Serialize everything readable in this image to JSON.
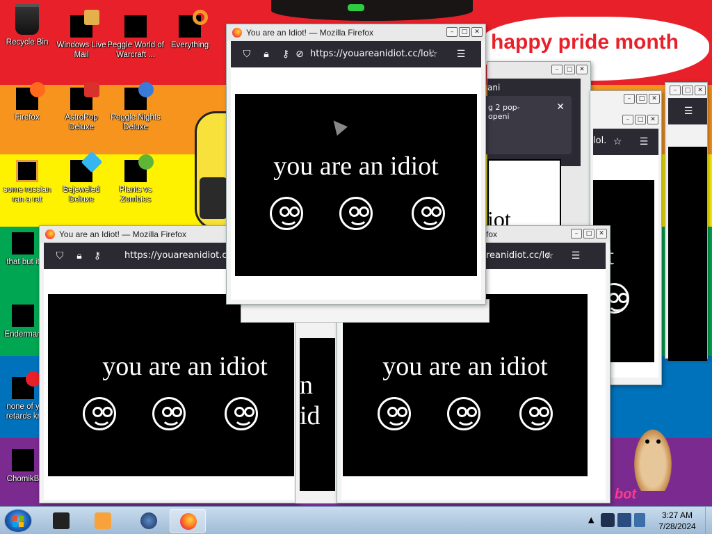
{
  "wallpaper": {
    "bands": [
      "#e8202a",
      "#f7941d",
      "#fff200",
      "#00a651",
      "#0072bc",
      "#7b2b8f"
    ],
    "banner_text": "happy pride month",
    "corner_text": "bot"
  },
  "desktop_icons": [
    {
      "label": "Recycle Bin",
      "icon": "recycle-bin-icon"
    },
    {
      "label": "Windows Live Mail",
      "icon": "mail-icon"
    },
    {
      "label": "Peggle World of Warcraft ...",
      "icon": "peggle-icon"
    },
    {
      "label": "Everything",
      "icon": "search-icon"
    },
    {
      "label": "Firefox",
      "icon": "firefox-icon"
    },
    {
      "label": "AstroPop Deluxe",
      "icon": "game-icon"
    },
    {
      "label": "Peggle Nights Deluxe",
      "icon": "peggle-icon"
    },
    {
      "label": "some russian ran a rat",
      "icon": "file-icon"
    },
    {
      "label": "Bejeweled Deluxe",
      "icon": "gem-icon"
    },
    {
      "label": "Plants vs Zombies",
      "icon": "plant-icon"
    },
    {
      "label": "that but it",
      "icon": "file-icon"
    },
    {
      "label": "Enderman",
      "icon": "file-icon"
    },
    {
      "label": "none of y retards kr",
      "icon": "file-icon"
    },
    {
      "label": "ChomikB",
      "icon": "file-icon"
    }
  ],
  "window_front": {
    "title": "You are an Idiot! — Mozilla Firefox",
    "url": "https://youareanidiot.cc/lol.",
    "headline": "you are an idiot"
  },
  "window_left": {
    "title": "You are an Idiot! — Mozilla Firefox",
    "url": "https://youareanidiot.co",
    "headline": "you are an idiot"
  },
  "window_mid_bottom": {
    "title_fragment": "fox",
    "url_fragment": "areanidiot.cc/lol.",
    "headline": "you are an idiot",
    "behind_fragment": "n id"
  },
  "window_back": {
    "title_fragment": "ani",
    "notification_text": "g 2 pop-\nopeni",
    "headline_fragment": "iot"
  },
  "window_right": {
    "url_fragment": "lol.",
    "headline_fragment": "t"
  },
  "taskbar": {
    "time": "3:27 AM",
    "date": "7/28/2024",
    "items": [
      "app-icon",
      "media-player-icon",
      "globe-icon",
      "firefox-icon"
    ]
  }
}
